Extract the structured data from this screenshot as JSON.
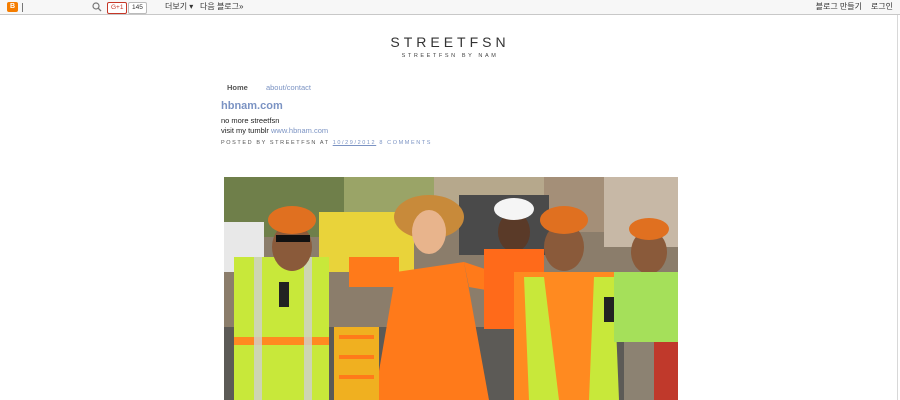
{
  "navbar": {
    "gplus_label": "G+1",
    "count": "145",
    "more_label": "더보기 ▾",
    "next_blog_label": "다음 블로그»",
    "create_blog_label": "블로그 만들기",
    "login_label": "로그인"
  },
  "header": {
    "title": "STREETFSN",
    "description": "STREETFSN BY NAM"
  },
  "tabs": [
    {
      "label": "Home"
    },
    {
      "label": "about/contact"
    }
  ],
  "post": {
    "title": "hbnam.com",
    "line1": "no more streetfsn",
    "line2_prefix": "visit my tumblr ",
    "line2_link": "www.hbnam.com",
    "footer_prefix": "POSTED BY STREETFSN AT ",
    "footer_time": "10/29/2012",
    "footer_comments": "8 COMMENTS"
  },
  "colors": {
    "link": "#7b93c3",
    "navbar_bg": "#f7f7f7",
    "orange_dress": "#ff7a1a",
    "safety_vest": "#c8e83a"
  }
}
